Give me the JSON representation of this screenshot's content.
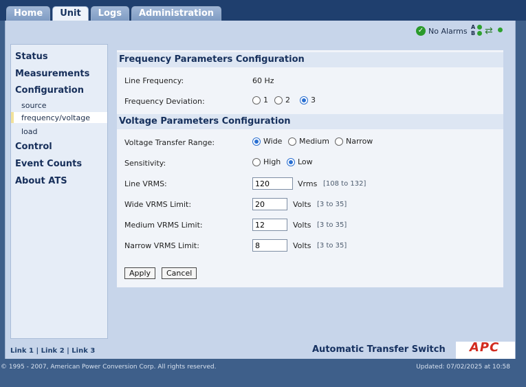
{
  "tabs": [
    "Home",
    "Unit",
    "Logs",
    "Administration"
  ],
  "active_tab": "Unit",
  "status": {
    "alarm_text": "No Alarms",
    "source_a": "A",
    "source_b": "B"
  },
  "nav": {
    "status": "Status",
    "measurements": "Measurements",
    "configuration": "Configuration",
    "sub_source": "source",
    "sub_freq": "frequency/voltage",
    "sub_load": "load",
    "control": "Control",
    "event_counts": "Event Counts",
    "about": "About ATS"
  },
  "freq": {
    "title": "Frequency Parameters Configuration",
    "line_freq_label": "Line Frequency:",
    "line_freq_value": "60 Hz",
    "deviation_label": "Frequency Deviation:",
    "deviation_options": [
      "1",
      "2",
      "3"
    ],
    "deviation_selected": "3"
  },
  "volt": {
    "title": "Voltage Parameters Configuration",
    "range_label": "Voltage Transfer Range:",
    "range_options": [
      "Wide",
      "Medium",
      "Narrow"
    ],
    "range_selected": "Wide",
    "sens_label": "Sensitivity:",
    "sens_options": [
      "High",
      "Low"
    ],
    "sens_selected": "Low",
    "line_vrms_label": "Line VRMS:",
    "line_vrms_value": "120",
    "line_vrms_unit": "Vrms",
    "line_vrms_range": "[108 to 132]",
    "wide_label": "Wide VRMS Limit:",
    "wide_value": "20",
    "medium_label": "Medium VRMS Limit:",
    "medium_value": "12",
    "narrow_label": "Narrow VRMS Limit:",
    "narrow_value": "8",
    "volts_unit": "Volts",
    "limit_range": "[3 to 35]"
  },
  "buttons": {
    "apply": "Apply",
    "cancel": "Cancel"
  },
  "footer": {
    "link1": "Link 1",
    "link2": "Link 2",
    "link3": "Link 3",
    "sep": "|",
    "product": "Automatic Transfer Switch",
    "logo": "APC",
    "copyright": "© 1995 - 2007, American Power Conversion Corp. All rights reserved.",
    "updated": "Updated: 07/02/2025 at 10:58"
  }
}
